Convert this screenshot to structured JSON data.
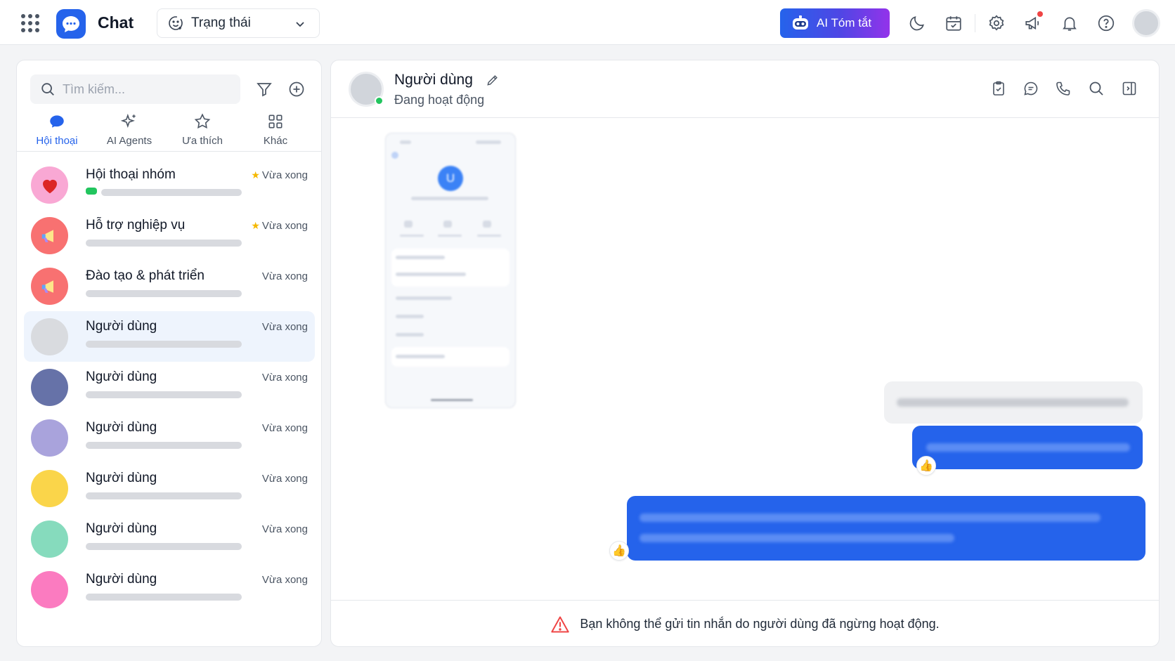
{
  "app": {
    "title": "Chat"
  },
  "status_select": {
    "label": "Trạng thái"
  },
  "ai_button": {
    "label": "AI Tóm tắt"
  },
  "colors": {
    "accent": "#2563eb",
    "online": "#22c55e",
    "warning": "#ef4444"
  },
  "sidebar": {
    "search_placeholder": "Tìm kiếm...",
    "tabs": [
      {
        "label": "Hội thoại",
        "icon": "chat-bubble-icon",
        "active": true
      },
      {
        "label": "AI Agents",
        "icon": "sparkle-icon",
        "active": false
      },
      {
        "label": "Ưa thích",
        "icon": "star-icon",
        "active": false
      },
      {
        "label": "Khác",
        "icon": "grid-icon",
        "active": false
      }
    ],
    "conversations": [
      {
        "name": "Hội thoại nhóm",
        "time": "Vừa xong",
        "starred": true,
        "avatar": "heart",
        "color": "#f9a8d4"
      },
      {
        "name": "Hỗ trợ nghiệp vụ",
        "time": "Vừa xong",
        "starred": true,
        "avatar": "megaphone",
        "color": "#f87171"
      },
      {
        "name": "Đào tạo & phát triển",
        "time": "Vừa xong",
        "starred": false,
        "avatar": "megaphone",
        "color": "#f87171"
      },
      {
        "name": "Người dùng",
        "time": "Vừa xong",
        "starred": false,
        "avatar": "plain",
        "color": "#d9dbdf",
        "active": true
      },
      {
        "name": "Người dùng",
        "time": "Vừa xong",
        "starred": false,
        "avatar": "plain",
        "color": "#6672a8"
      },
      {
        "name": "Người dùng",
        "time": "Vừa xong",
        "starred": false,
        "avatar": "plain",
        "color": "#a9a3dc"
      },
      {
        "name": "Người dùng",
        "time": "Vừa xong",
        "starred": false,
        "avatar": "plain",
        "color": "#fad54a"
      },
      {
        "name": "Người dùng",
        "time": "Vừa xong",
        "starred": false,
        "avatar": "plain",
        "color": "#86dbbd"
      },
      {
        "name": "Người dùng",
        "time": "Vừa xong",
        "starred": false,
        "avatar": "plain",
        "color": "#fb7bc0"
      }
    ]
  },
  "chat": {
    "name": "Người dùng",
    "status": "Đang hoạt động",
    "image_avatar_letter": "U",
    "reaction": "👍",
    "footer_warning": "Bạn không thể gửi tin nhắn do người dùng đã ngừng hoạt động."
  }
}
